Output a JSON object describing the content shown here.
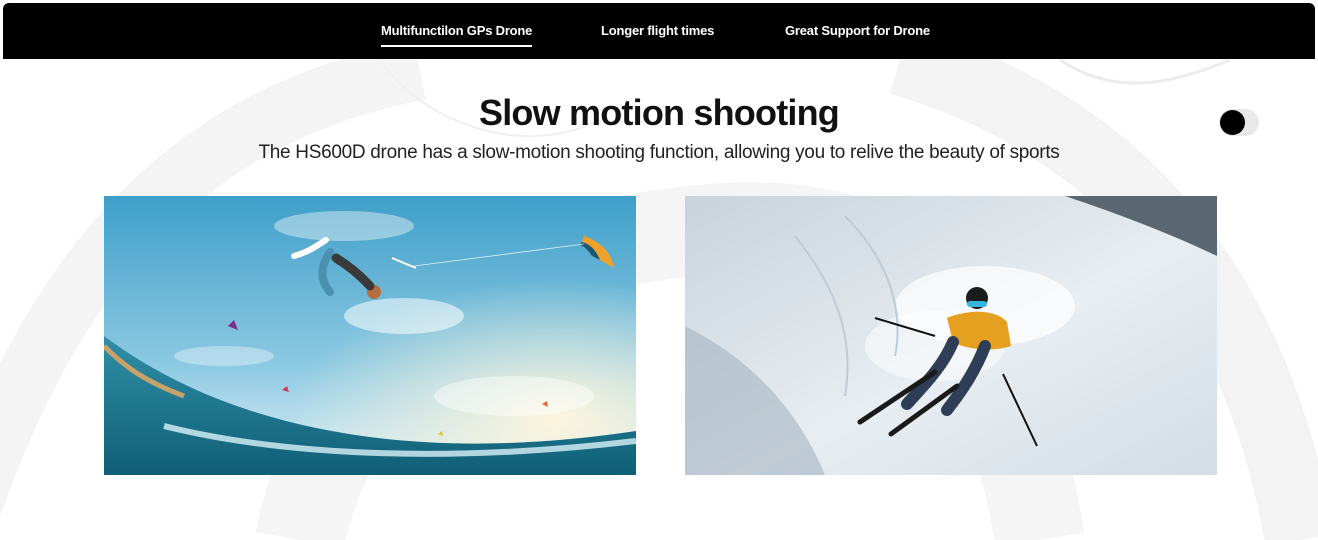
{
  "nav": {
    "items": [
      {
        "label": "Multifunctilon GPs Drone",
        "active": true
      },
      {
        "label": "Longer flight times",
        "active": false
      },
      {
        "label": "Great Support for Drone",
        "active": false
      }
    ]
  },
  "section": {
    "title": "Slow motion shooting",
    "subtitle": "The HS600D drone has a slow-motion shooting function, allowing you to relive the beauty of sports"
  },
  "toggle": {
    "state": "off"
  },
  "images": [
    {
      "subject": "kitesurfer-photo"
    },
    {
      "subject": "skier-photo"
    }
  ],
  "colors": {
    "nav_bg": "#000000",
    "accent_text": "#111111"
  }
}
